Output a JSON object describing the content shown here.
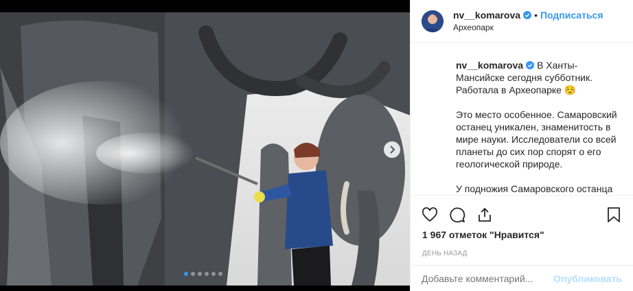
{
  "post": {
    "username": "nv__komarova",
    "follow_label": "Подписаться",
    "separator": "•",
    "location": "Археопарк",
    "caption_p1": "В Ханты-Мансийске сегодня субботник. Работала в Археопарке ☺️",
    "caption_p2": "Это место особенное. Самаровский останец уникален, знаменитость в мире науки. Исследователи со всей планеты до сих пор спорят о его геологической природе.",
    "caption_p3": "У подножия Самаровского останца",
    "likes_text": "1 967 отметок \"Нравится\"",
    "time_text": "ДЕНЬ НАЗАД",
    "comment_placeholder": "Добавьте комментарий...",
    "publish_label": "Опубликовать"
  },
  "carousel": {
    "count": 6,
    "active_index": 0
  },
  "colors": {
    "accent": "#3897f0",
    "publish_disabled": "#b2dffc",
    "muted": "#999999"
  }
}
